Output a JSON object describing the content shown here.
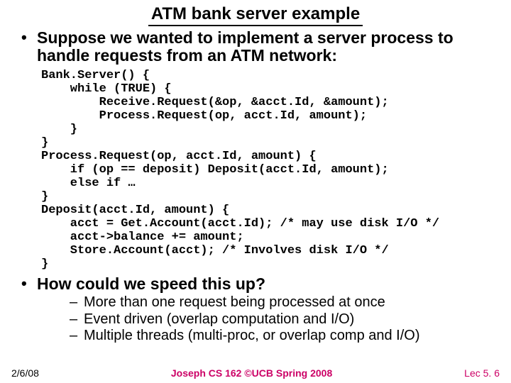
{
  "title": "ATM bank server example",
  "bullet1": "Suppose we wanted to implement a server process to handle requests from an ATM network:",
  "code": "Bank.Server() {\n    while (TRUE) {\n        Receive.Request(&op, &acct.Id, &amount);\n        Process.Request(op, acct.Id, amount);\n    }\n}\nProcess.Request(op, acct.Id, amount) {\n    if (op == deposit) Deposit(acct.Id, amount);\n    else if …\n}\nDeposit(acct.Id, amount) {\n    acct = Get.Account(acct.Id); /* may use disk I/O */\n    acct->balance += amount;\n    Store.Account(acct); /* Involves disk I/O */\n}",
  "bullet2": "How could we speed this up?",
  "sub": {
    "a": "More than one request being processed at once",
    "b": "Event driven (overlap computation and I/O)",
    "c": "Multiple threads (multi-proc, or overlap comp and I/O)"
  },
  "footer": {
    "date": "2/6/08",
    "center": "Joseph CS 162 ©UCB Spring 2008",
    "lec": "Lec 5. 6"
  }
}
